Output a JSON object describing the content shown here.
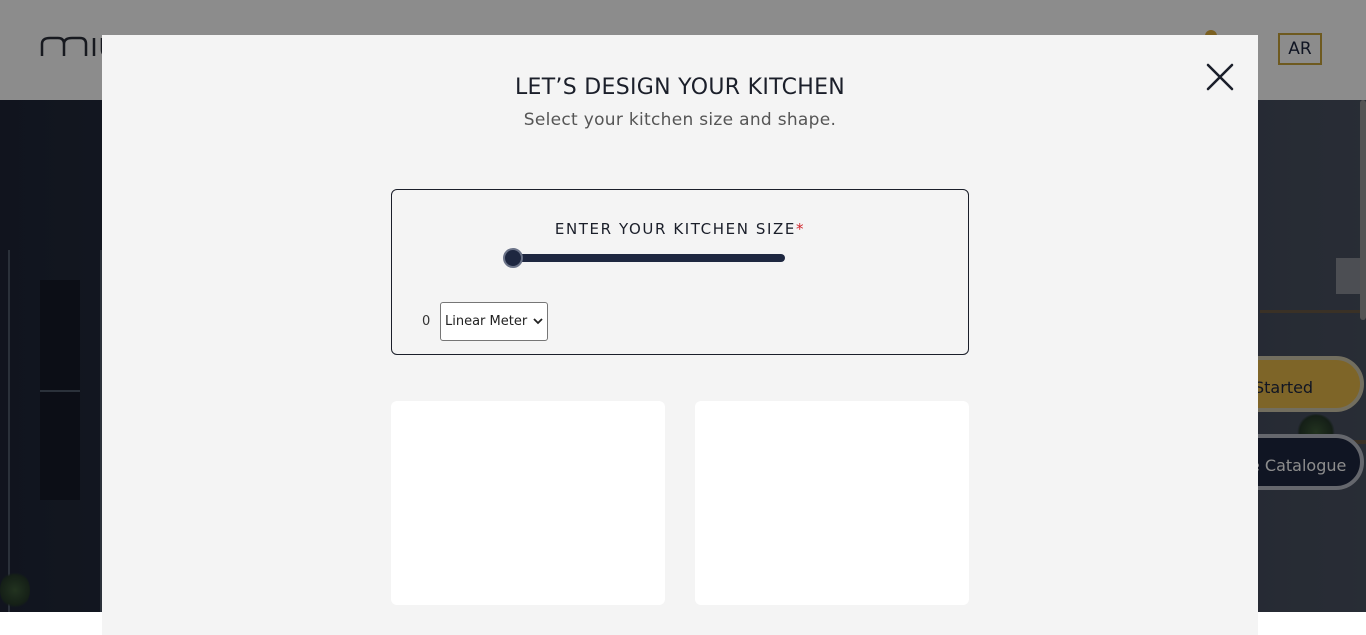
{
  "header": {
    "language_button": "AR"
  },
  "hero": {
    "get_started_label": "Started",
    "catalogue_label": "e Catalogue"
  },
  "modal": {
    "title": "LET’S DESIGN YOUR KITCHEN",
    "subtitle": "Select your kitchen size and shape.",
    "size_section": {
      "label": "ENTER YOUR KITCHEN SIZE",
      "required_marker": "*",
      "slider_value": 0,
      "value_text": "0",
      "unit_selected": "Linear Meter"
    },
    "shape_cards_count": 2
  },
  "colors": {
    "primary_navy": "#1e2740",
    "accent_gold": "#e6b84a",
    "required_red": "#d0262c",
    "modal_bg": "#f4f4f4"
  },
  "icons": [
    "close-icon",
    "chevron-down-icon"
  ]
}
